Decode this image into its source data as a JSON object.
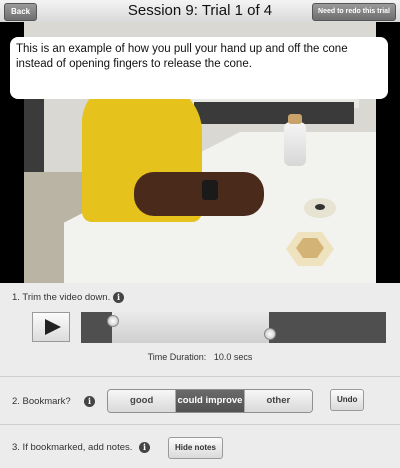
{
  "header": {
    "back_label": "Back",
    "title": "Session 9: Trial 1 of 4",
    "redo_label": "Need to redo this trial"
  },
  "video": {
    "caption": "This is an example of how you pull your hand up and off the cone instead of opening fingers to release the cone."
  },
  "trim": {
    "label": "1. Trim the video down.",
    "duration_label": "Time Duration:",
    "duration_value": "10.0",
    "duration_unit": "secs",
    "selection_start_fraction": 0.1,
    "selection_end_fraction": 0.62
  },
  "bookmark": {
    "label": "2. Bookmark?",
    "options": [
      "good",
      "could improve",
      "other"
    ],
    "selected": "could improve",
    "undo_label": "Undo"
  },
  "notes": {
    "label": "3. If bookmarked, add notes.",
    "hide_label": "Hide notes"
  },
  "icons": {
    "info": "info-icon",
    "play": "play-icon"
  }
}
